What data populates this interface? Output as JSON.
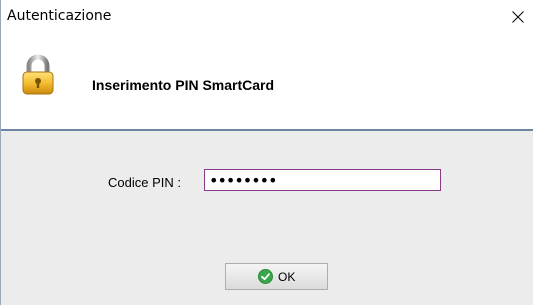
{
  "window": {
    "title": "Autenticazione"
  },
  "header": {
    "title": "Inserimento PIN SmartCard",
    "icon": "lock-icon"
  },
  "form": {
    "pin_label": "Codice PIN :",
    "pin_value": "••••••••"
  },
  "buttons": {
    "ok_label": "OK",
    "ok_icon": "check-icon"
  },
  "colors": {
    "divider": "#6f86a3",
    "panel_background": "#ececec",
    "input_border": "#8a3a8a",
    "ok_icon": "#3aa64a"
  }
}
